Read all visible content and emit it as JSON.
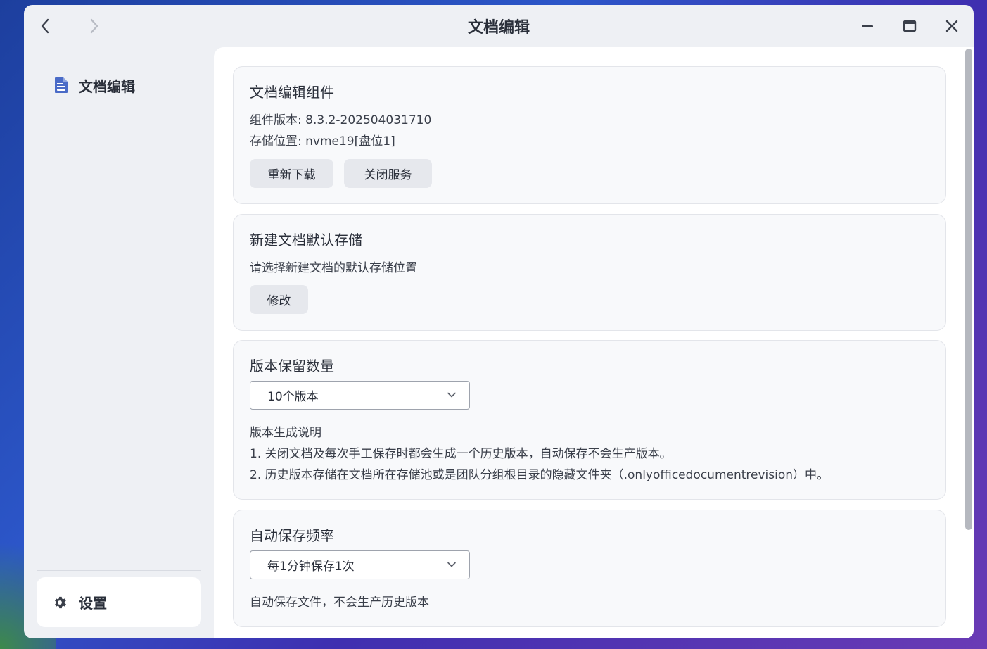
{
  "window": {
    "title": "文档编辑"
  },
  "sidebar": {
    "items": [
      {
        "label": "文档编辑",
        "icon": "document-icon"
      }
    ],
    "settings_label": "设置"
  },
  "sections": {
    "component": {
      "title": "文档编辑组件",
      "version_line": "组件版本: 8.3.2-202504031710",
      "storage_line": "存储位置: nvme19[盘位1]",
      "redownload_label": "重新下载",
      "stop_service_label": "关闭服务"
    },
    "default_storage": {
      "title": "新建文档默认存储",
      "description": "请选择新建文档的默认存储位置",
      "modify_label": "修改"
    },
    "version_retention": {
      "title": "版本保留数量",
      "selected": "10个版本",
      "notes_title": "版本生成说明",
      "note_1": "1. 关闭文档及每次手工保存时都会生成一个历史版本，自动保存不会生产版本。",
      "note_2": "2. 历史版本存储在文档所在存储池或是团队分组根目录的隐藏文件夹（.onlyofficedocumentrevision）中。"
    },
    "autosave": {
      "title": "自动保存频率",
      "selected": "每1分钟保存1次",
      "description": "自动保存文件，不会生产历史版本"
    }
  },
  "colors": {
    "accent_icon": "#4a6bc7",
    "window_bg": "#eef0f4",
    "card_bg": "#f8f9fb"
  }
}
